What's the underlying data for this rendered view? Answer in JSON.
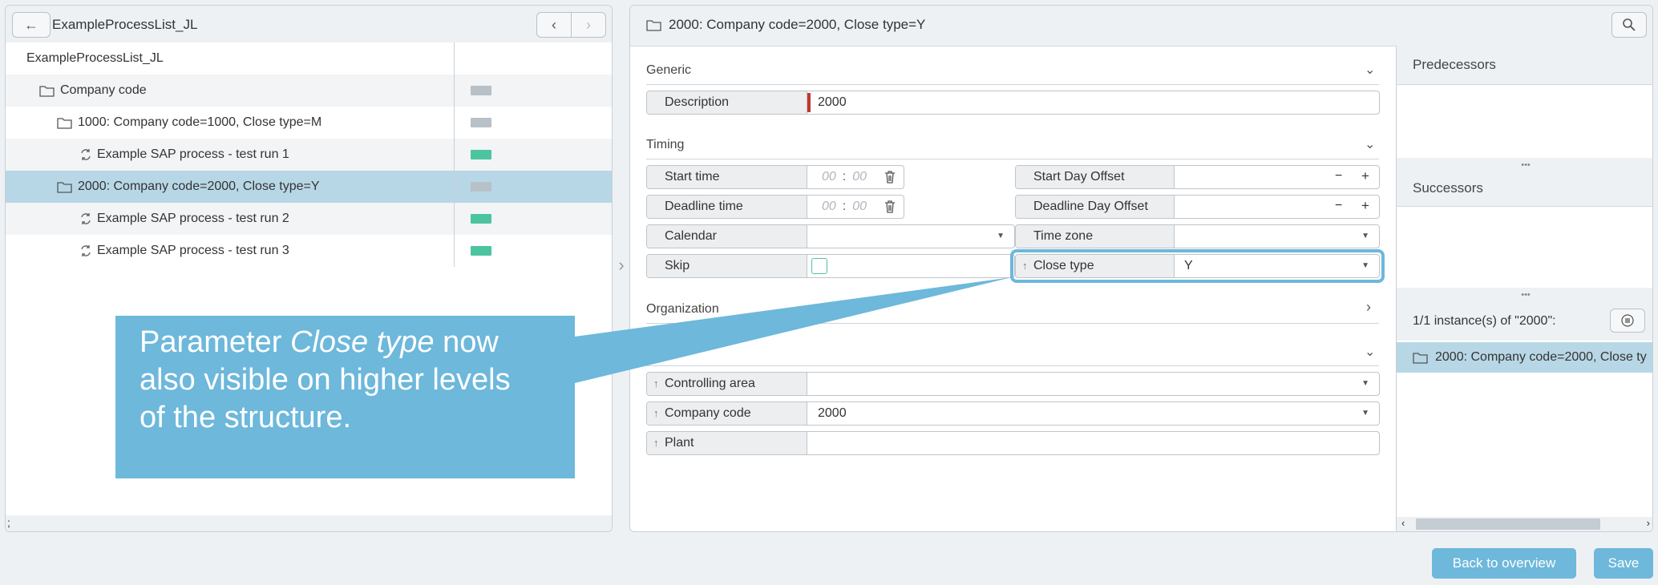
{
  "left_panel": {
    "title": "ExampleProcessList_JL",
    "back_icon": "arrow-left-icon",
    "tree": [
      {
        "label": "ExampleProcessList_JL",
        "icon": "none",
        "marker": "none"
      },
      {
        "label": "Company code",
        "icon": "folder-icon",
        "marker": "gray"
      },
      {
        "label": "1000: Company code=1000, Close type=M",
        "icon": "folder-icon",
        "marker": "gray"
      },
      {
        "label": "Example SAP process - test run 1",
        "icon": "process-icon",
        "marker": "green"
      },
      {
        "label": "2000: Company code=2000, Close type=Y",
        "icon": "folder-icon",
        "marker": "gray"
      },
      {
        "label": "Example SAP process - test run 2",
        "icon": "process-icon",
        "marker": "green"
      },
      {
        "label": "Example SAP process - test run 3",
        "icon": "process-icon",
        "marker": "green"
      }
    ],
    "footer_text": ";"
  },
  "detail": {
    "title": "2000: Company code=2000, Close type=Y",
    "sections": {
      "generic": "Generic",
      "timing": "Timing",
      "organization": "Organization"
    },
    "fields": {
      "description": {
        "label": "Description",
        "value": "2000"
      },
      "start_time": {
        "label": "Start time",
        "hh": "00",
        "mm": "00"
      },
      "deadline_time": {
        "label": "Deadline time",
        "hh": "00",
        "mm": "00"
      },
      "calendar": {
        "label": "Calendar",
        "value": ""
      },
      "skip": {
        "label": "Skip"
      },
      "start_day_offset": {
        "label": "Start Day Offset",
        "value": ""
      },
      "deadline_day_offset": {
        "label": "Deadline Day Offset",
        "value": ""
      },
      "time_zone": {
        "label": "Time zone",
        "value": ""
      },
      "close_type": {
        "label": "Close type",
        "value": "Y"
      },
      "controlling_area": {
        "label": "Controlling area",
        "value": ""
      },
      "company_code": {
        "label": "Company code",
        "value": "2000"
      },
      "plant": {
        "label": "Plant",
        "value": ""
      }
    },
    "time_separator": ":",
    "minus": "−",
    "plus": "+"
  },
  "side": {
    "predecessors": "Predecessors",
    "successors": "Successors",
    "instances": "1/1 instance(s) of \"2000\":",
    "instance_item": "2000: Company code=2000, Close ty",
    "dots": "•••"
  },
  "callout": {
    "line1_pre": "Parameter ",
    "line1_em": "Close type",
    "line1_post": " now",
    "line2": "also visible on higher levels",
    "line3": "of the structure."
  },
  "actions": {
    "back": "Back to overview",
    "save": "Save"
  },
  "colors": {
    "accent": "#6db8db",
    "selected_row": "#b8d7e6",
    "marker_gray": "#b8c0c8",
    "marker_green": "#4cc4a0",
    "required": "#c0392b"
  }
}
